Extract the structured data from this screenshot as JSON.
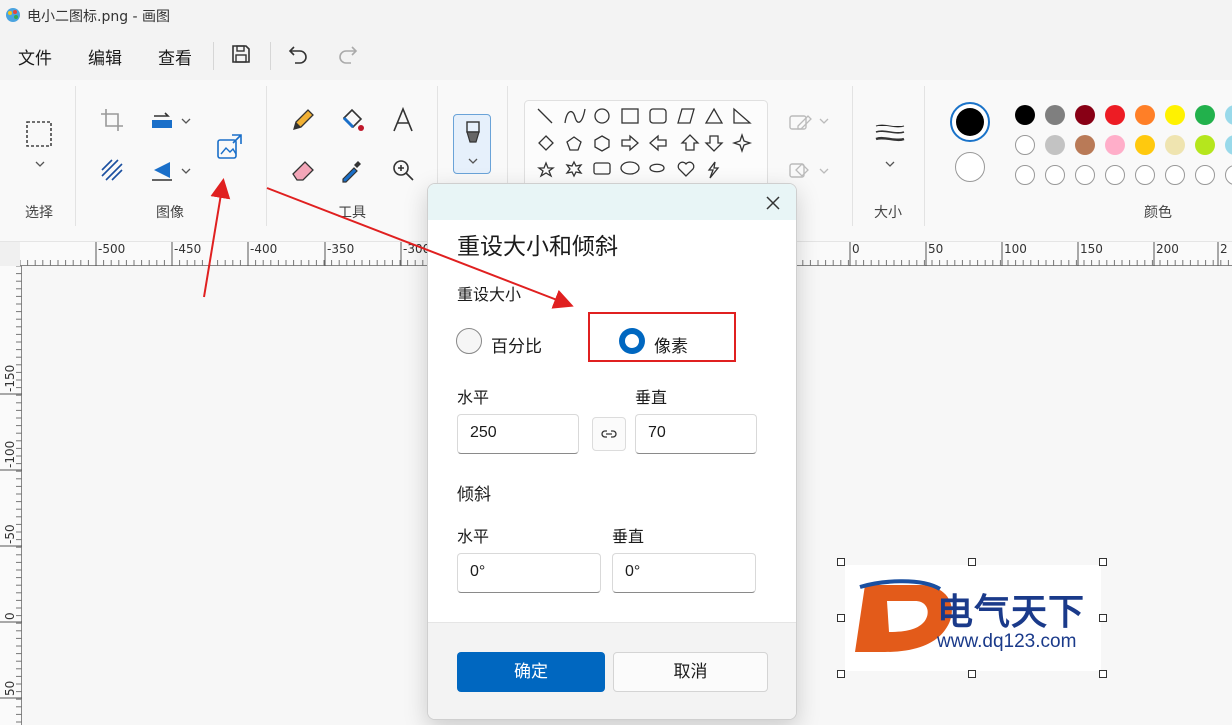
{
  "window": {
    "title": "电小二图标.png - 画图"
  },
  "menu": {
    "file": "文件",
    "edit": "编辑",
    "view": "查看"
  },
  "ribbon": {
    "groups": {
      "select": "选择",
      "image": "图像",
      "tools": "工具",
      "size": "大小",
      "colors": "颜色"
    }
  },
  "rulers": {
    "h_labels": [
      "-500",
      "-450",
      "-400",
      "-350",
      "-300",
      "0",
      "50",
      "100",
      "150",
      "200",
      "2"
    ],
    "v_labels": [
      "-150",
      "-100",
      "-50",
      "0",
      "50"
    ]
  },
  "dialog": {
    "title": "重设大小和倾斜",
    "resize_section": "重设大小",
    "percent_label": "百分比",
    "pixels_label": "像素",
    "horizontal_label": "水平",
    "vertical_label": "垂直",
    "horizontal_value": "250",
    "vertical_value": "70",
    "skew_section": "倾斜",
    "skew_horizontal_label": "水平",
    "skew_vertical_label": "垂直",
    "skew_horizontal_value": "0°",
    "skew_vertical_value": "0°",
    "ok_label": "确定",
    "cancel_label": "取消"
  },
  "canvas_image": {
    "brand_text": "电气天下",
    "url_text": "www.dq123.com"
  },
  "palette": {
    "primary": "#000000",
    "secondary": "#ffffff",
    "row1": [
      "#000000",
      "#7f7f7f",
      "#880015",
      "#ed1c24",
      "#ff7f27",
      "#fff200",
      "#22b14c",
      "#99d9ea"
    ],
    "row2": [
      "#ffffff",
      "#c3c3c3",
      "#b97a57",
      "#ffaec9",
      "#ffc90e",
      "#efe4b0",
      "#b5e61d",
      "#99d9ea"
    ]
  }
}
